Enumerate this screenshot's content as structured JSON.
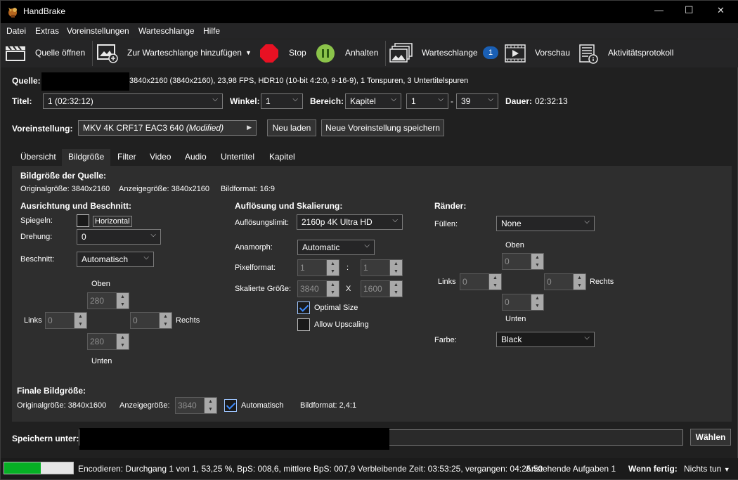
{
  "app": {
    "title": "HandBrake"
  },
  "window_controls": {
    "minimize": "—",
    "maximize": "☐",
    "close": "✕"
  },
  "menu": [
    "Datei",
    "Extras",
    "Voreinstellungen",
    "Warteschlange",
    "Hilfe"
  ],
  "toolbar": {
    "open_source": "Quelle öffnen",
    "add_queue": "Zur Warteschlange hinzufügen",
    "stop": "Stop",
    "pause": "Anhalten",
    "queue": "Warteschlange",
    "queue_count": "1",
    "preview": "Vorschau",
    "activity_log": "Aktivitätsprotokoll"
  },
  "source": {
    "label": "Quelle:",
    "info": "3840x2160 (3840x2160), 23,98 FPS, HDR10 (10-bit 4:2:0, 9-16-9), 1 Tonspuren, 3 Untertitelspuren"
  },
  "title_row": {
    "title_label": "Titel:",
    "title_value": "1  (02:32:12)",
    "angle_label": "Winkel:",
    "angle_value": "1",
    "range_label": "Bereich:",
    "range_type": "Kapitel",
    "range_from": "1",
    "range_dash": "-",
    "range_to": "39",
    "duration_label": "Dauer:",
    "duration_value": "02:32:13"
  },
  "preset": {
    "label": "Voreinstellung:",
    "value": "MKV 4K CRF17 EAC3 640",
    "modified": "(Modified)",
    "reload": "Neu laden",
    "save_new": "Neue Voreinstellung speichern"
  },
  "tabs": [
    "Übersicht",
    "Bildgröße",
    "Filter",
    "Video",
    "Audio",
    "Untertitel",
    "Kapitel"
  ],
  "active_tab": "Bildgröße",
  "dimensions": {
    "source_heading": "Bildgröße der Quelle:",
    "orig_size": "Originalgröße: 3840x2160",
    "display_size": "Anzeigegröße: 3840x2160",
    "aspect": "Bildformat: 16:9",
    "orientation_heading": "Ausrichtung und Beschnitt:",
    "mirror_label": "Spiegeln:",
    "mirror_option": "Horizontal",
    "rotation_label": "Drehung:",
    "rotation_value": "0",
    "crop_label": "Beschnitt:",
    "crop_mode": "Automatisch",
    "crop_top_label": "Oben",
    "crop_top": "280",
    "crop_left_label": "Links",
    "crop_left": "0",
    "crop_right": "0",
    "crop_right_label": "Rechts",
    "crop_bottom": "280",
    "crop_bottom_label": "Unten",
    "res_heading": "Auflösung und Skalierung:",
    "res_limit_label": "Auflösungslimit:",
    "res_limit_value": "2160p 4K Ultra HD",
    "anamorphic_label": "Anamorph:",
    "anamorphic_value": "Automatic",
    "pixel_label": "Pixelformat:",
    "pixel_w": "1",
    "pixel_colon": ":",
    "pixel_h": "1",
    "scaled_label": "Skalierte Größe:",
    "scaled_w": "3840",
    "scaled_x": "X",
    "scaled_h": "1600",
    "optimal_label": "Optimal Size",
    "optimal_checked": true,
    "upscale_label": "Allow Upscaling",
    "upscale_checked": false,
    "borders_heading": "Ränder:",
    "fill_label": "Füllen:",
    "fill_value": "None",
    "border_top_label": "Oben",
    "border_top": "0",
    "border_left_label": "Links",
    "border_left": "0",
    "border_right": "0",
    "border_right_label": "Rechts",
    "border_bottom": "0",
    "border_bottom_label": "Unten",
    "color_label": "Farbe:",
    "color_value": "Black",
    "final_heading": "Finale Bildgröße:",
    "final_orig": "Originalgröße: 3840x1600",
    "final_display_label": "Anzeigegröße:",
    "final_display_value": "3840",
    "final_auto": "Automatisch",
    "final_aspect": "Bildformat: 2,4:1"
  },
  "save": {
    "label": "Speichern unter:",
    "browse": "Wählen"
  },
  "status": {
    "progress": 0.5325,
    "text": "Encodieren: Durchgang 1 von 1, 53,25 %, BpS: 008,6, mittlere BpS: 007,9 Verbleibende Zeit: 03:53:25, vergangen: 04:25:50",
    "pending": "Anstehende Aufgaben 1",
    "when_done_label": "Wenn fertig:",
    "when_done_value": "Nichts tun"
  },
  "colors": {
    "accent_blue": "#1a5fb4",
    "progress_green": "#06b025",
    "stop_red": "#e81123",
    "pause_green": "#8bc34a"
  }
}
